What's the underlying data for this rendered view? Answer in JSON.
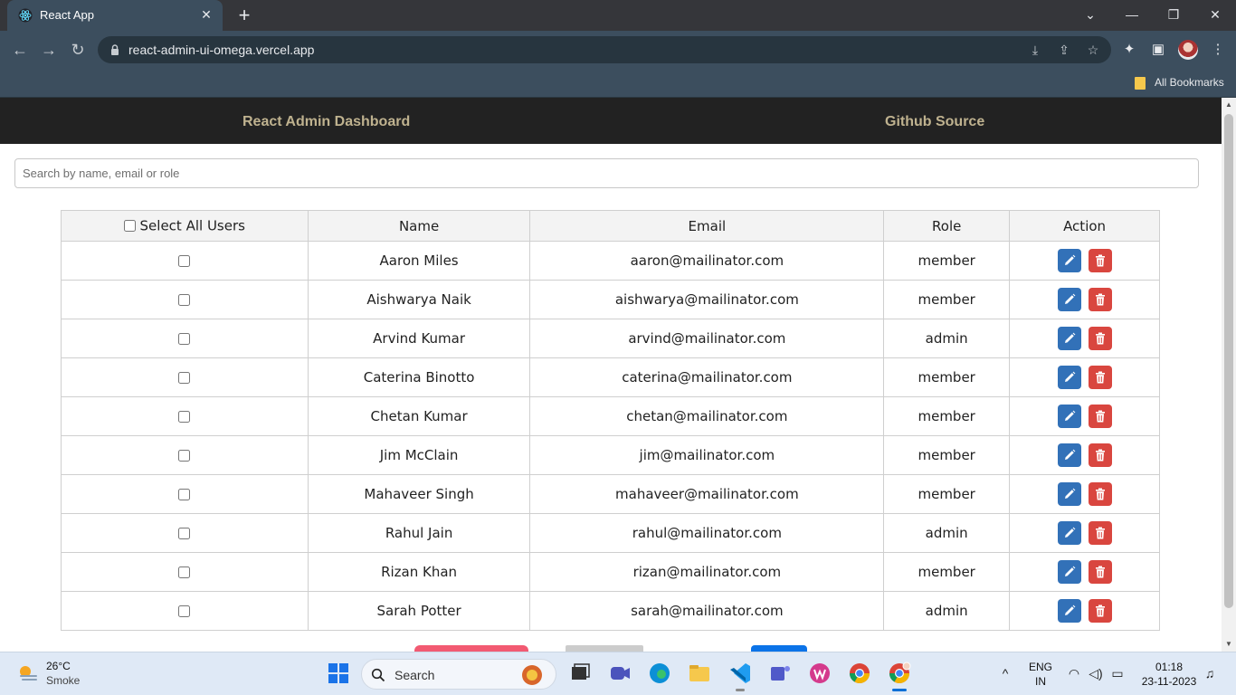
{
  "browser": {
    "tab_title": "React App",
    "url": "react-admin-ui-omega.vercel.app",
    "bookmarks_label": "All Bookmarks"
  },
  "app": {
    "nav": {
      "dashboard_label": "React Admin Dashboard",
      "github_label": "Github Source"
    },
    "search": {
      "placeholder": "Search by name, email or role",
      "value": ""
    },
    "table": {
      "headers": {
        "select_all": "Select All Users",
        "name": "Name",
        "email": "Email",
        "role": "Role",
        "action": "Action"
      },
      "rows": [
        {
          "name": "Aaron Miles",
          "email": "aaron@mailinator.com",
          "role": "member"
        },
        {
          "name": "Aishwarya Naik",
          "email": "aishwarya@mailinator.com",
          "role": "member"
        },
        {
          "name": "Arvind Kumar",
          "email": "arvind@mailinator.com",
          "role": "admin"
        },
        {
          "name": "Caterina Binotto",
          "email": "caterina@mailinator.com",
          "role": "member"
        },
        {
          "name": "Chetan Kumar",
          "email": "chetan@mailinator.com",
          "role": "member"
        },
        {
          "name": "Jim McClain",
          "email": "jim@mailinator.com",
          "role": "member"
        },
        {
          "name": "Mahaveer Singh",
          "email": "mahaveer@mailinator.com",
          "role": "member"
        },
        {
          "name": "Rahul Jain",
          "email": "rahul@mailinator.com",
          "role": "admin"
        },
        {
          "name": "Rizan Khan",
          "email": "rizan@mailinator.com",
          "role": "member"
        },
        {
          "name": "Sarah Potter",
          "email": "sarah@mailinator.com",
          "role": "admin"
        }
      ]
    },
    "colors": {
      "nav_bg": "#222222",
      "nav_link": "#bfb28f",
      "edit_button": "#3271b8",
      "delete_button": "#d9463f",
      "delete_selected_button": "#f25a72",
      "pagination_grey": "#cccccc",
      "pagination_blue": "#0b73e8"
    }
  },
  "taskbar": {
    "weather_temp": "26°C",
    "weather_desc": "Smoke",
    "search_label": "Search",
    "language": "ENG",
    "region": "IN",
    "time": "01:18",
    "date": "23-11-2023"
  },
  "icons": [
    "react-favicon",
    "close-icon",
    "plus-icon",
    "chevron-down-icon",
    "minimize-icon",
    "restore-icon",
    "back-icon",
    "forward-icon",
    "reload-icon",
    "lock-icon",
    "install-icon",
    "share-icon",
    "star-icon",
    "extensions-icon",
    "sidebar-icon",
    "kebab-menu-icon",
    "folder-icon",
    "edit-icon",
    "trash-icon",
    "windows-start-icon",
    "search-icon"
  ]
}
